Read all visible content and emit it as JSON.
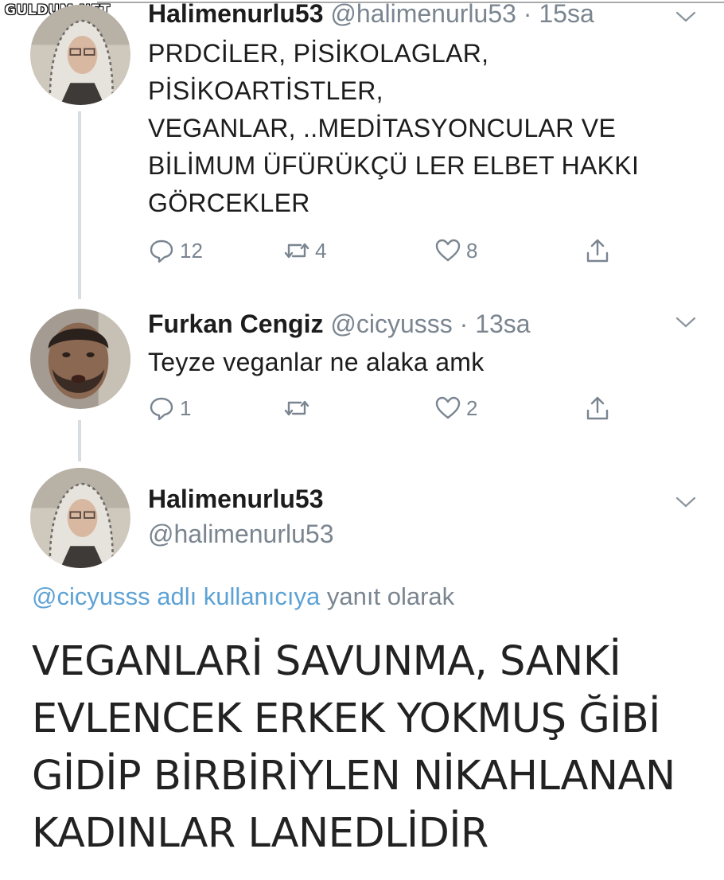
{
  "watermark": "GULDUM.NET",
  "tweets": [
    {
      "name": "Halimenurlu53",
      "handle": "@halimenurlu53",
      "time": "15sa",
      "lines": [
        "PRDCİLER, PİSİKOLAGLAR,",
        "PİSİKOARTİSTLER,",
        "VEGANLAR, ..MEDİTASYONCULAR VE",
        "BİLİMUM ÜFÜRÜKÇÜ LER ELBET HAKKI",
        "GÖRCEKLER"
      ],
      "reply_count": "12",
      "retweet_count": "4",
      "like_count": "8"
    },
    {
      "name": "Furkan Cengiz",
      "handle": "@cicyusss",
      "time": "13sa",
      "lines": [
        "Teyze veganlar ne alaka amk"
      ],
      "reply_count": "1",
      "retweet_count": "",
      "like_count": "2"
    }
  ],
  "main": {
    "name": "Halimenurlu53",
    "handle": "@halimenurlu53",
    "reply_to_handle": "@cicyusss adlı kullanıcıya",
    "reply_to_rest": "yanıt olarak",
    "lines": [
      "VEGANLARİ  SAVUNMA, SANKİ",
      "EVLENCEK ERKEK YOKMUŞ ĞİBİ",
      "GİDİP BİRBİRİYLEN NİKAHLANAN",
      "KADINLAR LANEDLİDİR"
    ]
  },
  "colors": {
    "text": "#1c1c1c",
    "meta": "#7a8590",
    "link": "#5ea2d4",
    "thread_line": "#d8dde1"
  },
  "icons": [
    "reply-icon",
    "retweet-icon",
    "like-icon",
    "share-icon",
    "chevron-down-icon"
  ]
}
